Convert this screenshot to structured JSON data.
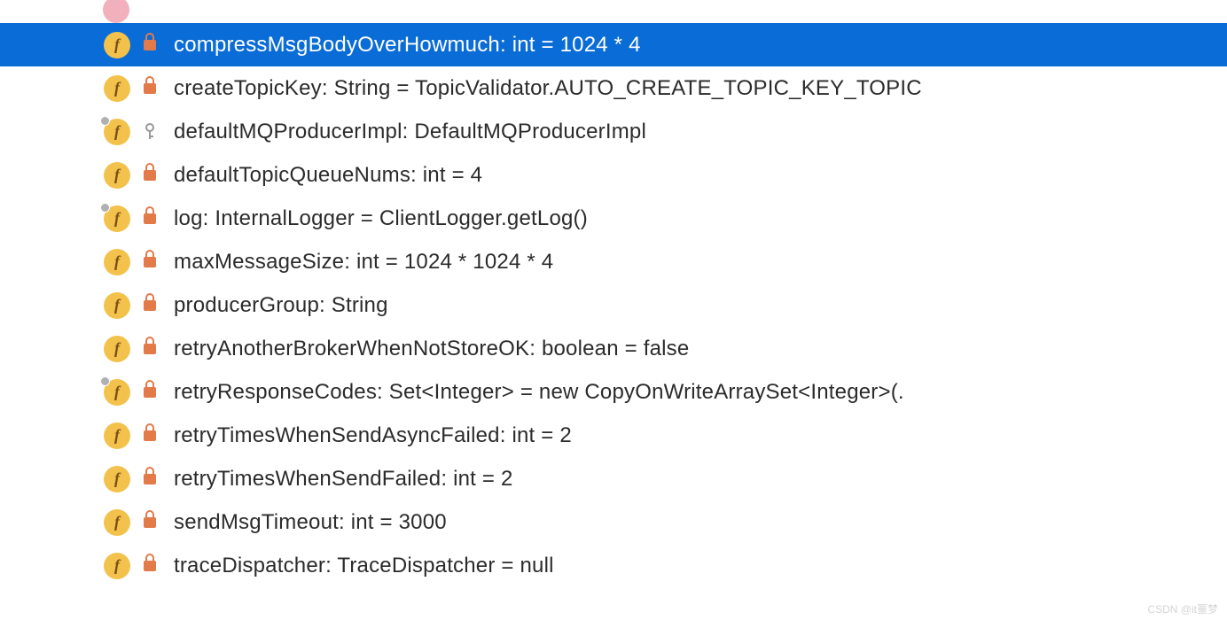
{
  "partial_top_text": "· · · · · · · - - - - - - - - \\ - - · · · · O / - - · · · · O / · - · · - - - - O - - - - - -",
  "rows": [
    {
      "name": "compressMsgBodyOverHowmuch",
      "label": "compressMsgBodyOverHowmuch: int = 1024 * 4",
      "selected": true,
      "static": false,
      "access": "private"
    },
    {
      "name": "createTopicKey",
      "label": "createTopicKey: String = TopicValidator.AUTO_CREATE_TOPIC_KEY_TOPIC",
      "selected": false,
      "static": false,
      "access": "private"
    },
    {
      "name": "defaultMQProducerImpl",
      "label": "defaultMQProducerImpl: DefaultMQProducerImpl",
      "selected": false,
      "static": true,
      "access": "protected"
    },
    {
      "name": "defaultTopicQueueNums",
      "label": "defaultTopicQueueNums: int = 4",
      "selected": false,
      "static": false,
      "access": "private"
    },
    {
      "name": "log",
      "label": "log: InternalLogger = ClientLogger.getLog()",
      "selected": false,
      "static": true,
      "access": "private"
    },
    {
      "name": "maxMessageSize",
      "label": "maxMessageSize: int = 1024 * 1024 * 4",
      "selected": false,
      "static": false,
      "access": "private"
    },
    {
      "name": "producerGroup",
      "label": "producerGroup: String",
      "selected": false,
      "static": false,
      "access": "private"
    },
    {
      "name": "retryAnotherBrokerWhenNotStoreOK",
      "label": "retryAnotherBrokerWhenNotStoreOK: boolean = false",
      "selected": false,
      "static": false,
      "access": "private"
    },
    {
      "name": "retryResponseCodes",
      "label": "retryResponseCodes: Set<Integer> = new CopyOnWriteArraySet<Integer>(.",
      "selected": false,
      "static": true,
      "access": "private"
    },
    {
      "name": "retryTimesWhenSendAsyncFailed",
      "label": "retryTimesWhenSendAsyncFailed: int = 2",
      "selected": false,
      "static": false,
      "access": "private"
    },
    {
      "name": "retryTimesWhenSendFailed",
      "label": "retryTimesWhenSendFailed: int = 2",
      "selected": false,
      "static": false,
      "access": "private"
    },
    {
      "name": "sendMsgTimeout",
      "label": "sendMsgTimeout: int = 3000",
      "selected": false,
      "static": false,
      "access": "private"
    },
    {
      "name": "traceDispatcher",
      "label": "traceDispatcher: TraceDispatcher = null",
      "selected": false,
      "static": false,
      "access": "private"
    }
  ],
  "watermark": "CSDN @it噩梦"
}
